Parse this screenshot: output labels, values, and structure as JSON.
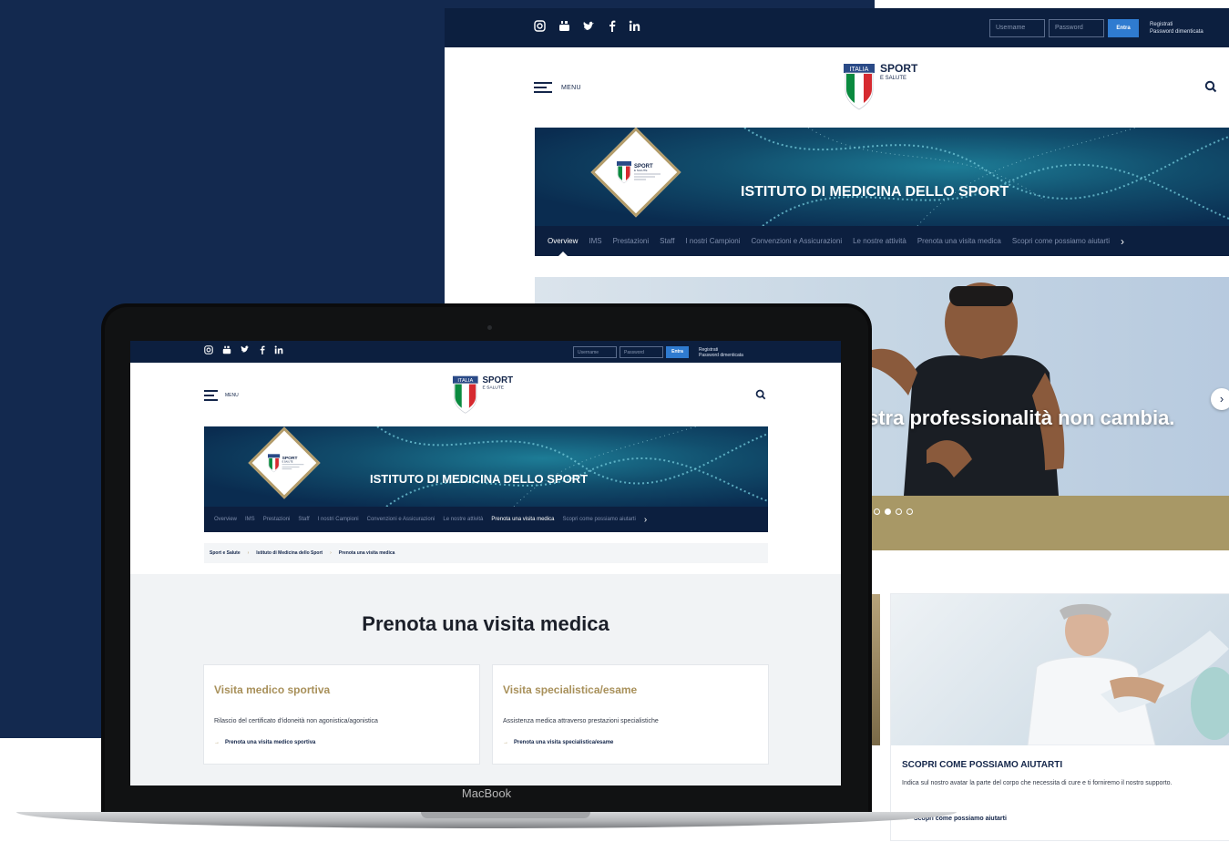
{
  "site": {
    "social_icons": [
      "instagram-icon",
      "youtube-icon",
      "twitter-icon",
      "facebook-icon",
      "linkedin-icon"
    ],
    "login": {
      "username_placeholder": "Username",
      "password_placeholder": "Password",
      "submit_label": "Entra",
      "register_label": "Registrati",
      "forgot_label": "Password dimenticata"
    },
    "menu_label": "MENU",
    "logo": {
      "badge": "ITALIA",
      "name": "SPORT",
      "sub": "E SALUTE"
    },
    "banner_title": "ISTITUTO DI MEDICINA DELLO SPORT",
    "tabs": [
      "Overview",
      "IMS",
      "Prestazioni",
      "Staff",
      "I nostri Campioni",
      "Convenzioni e Assicurazioni",
      "Le nostre attività",
      "Prenota una visita medica",
      "Scopri come possiamo aiutarti"
    ],
    "desktop_active_tab": "Overview",
    "laptop_active_tab": "Prenota una visita medica"
  },
  "desktop": {
    "hero_text": "stra professionalità non cambia.",
    "help_card": {
      "title": "SCOPRI COME POSSIAMO AIUTARTI",
      "text": "Indica sul nostro avatar la parte del corpo che necessita di cure e ti forniremo il nostro supporto.",
      "link": "Scopri come possiamo aiutarti"
    }
  },
  "laptop": {
    "device_label": "MacBook",
    "breadcrumb": [
      "Sport e Salute",
      "Istituto di Medicina dello Sport",
      "Prenota una visita medica"
    ],
    "page_title": "Prenota una visita medica",
    "cards": [
      {
        "title": "Visita medico sportiva",
        "text": "Rilascio del certificato d'idoneità non agonistica/agonistica",
        "link": "Prenota una visita medico sportiva"
      },
      {
        "title": "Visita specialistica/esame",
        "text": "Assistenza medica attraverso prestazioni specialistiche",
        "link": "Prenota una visita specialistica/esame"
      }
    ]
  },
  "colors": {
    "navy": "#13294f",
    "topbar": "#0c1f3f",
    "gold": "#b39c6a",
    "accent_blue": "#2f7bd0"
  }
}
